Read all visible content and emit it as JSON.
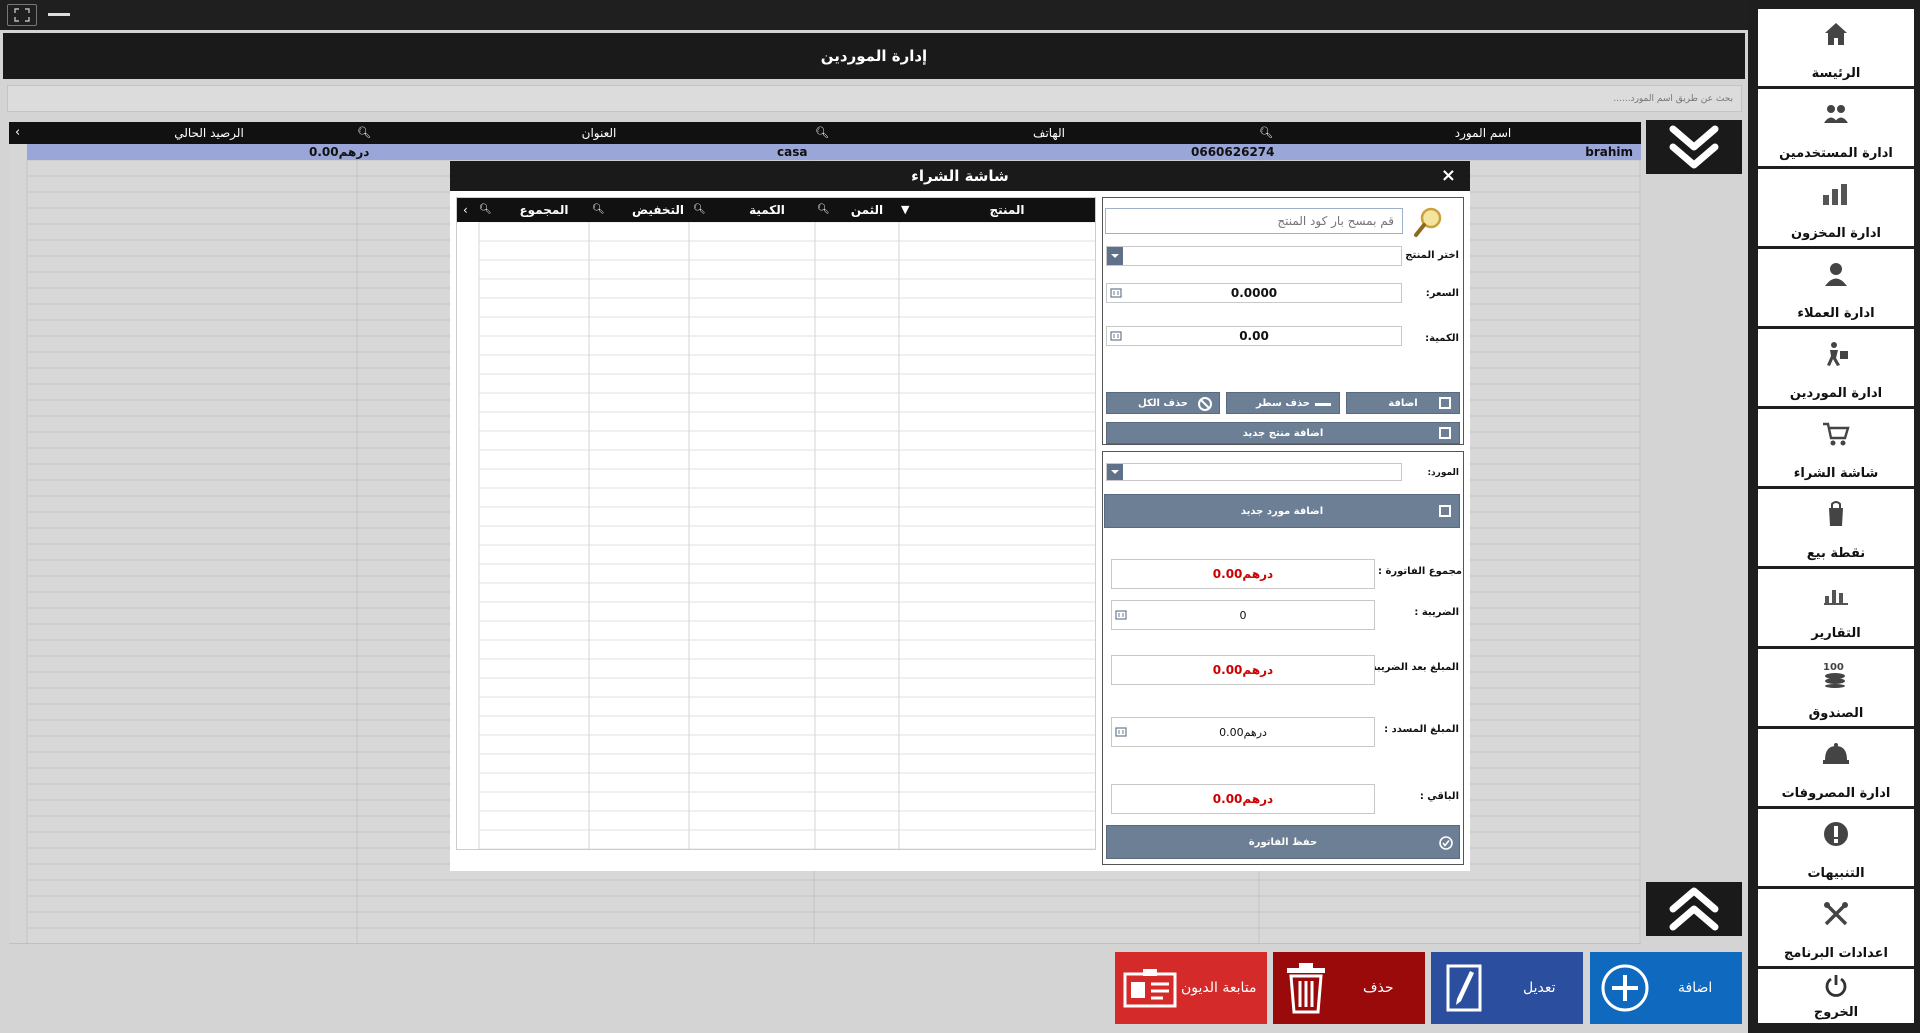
{
  "window": {
    "fullscreen_icon": "fullscreen-icon",
    "minimize_icon": "minimize-icon"
  },
  "page": {
    "title": "إدارة الموردين",
    "search_placeholder": "بحث عن طريق اسم المورد......"
  },
  "grid": {
    "columns": [
      "اسم المورد",
      "الهاتف",
      "العنوان",
      "الرصيد الحالي"
    ],
    "rows": [
      {
        "name": "brahim",
        "phone": "0660626274",
        "address": "casa",
        "balance": "درهم0.00"
      }
    ]
  },
  "actions": {
    "add": "اضافة",
    "edit": "تعديل",
    "delete": "حذف",
    "debts": "متابعة الديون"
  },
  "sidebar": {
    "items": [
      {
        "label": "الرئيسة",
        "icon": "home-icon"
      },
      {
        "label": "ادارة المستخدمين",
        "icon": "users-icon"
      },
      {
        "label": "ادارة المخزون",
        "icon": "inventory-icon"
      },
      {
        "label": "ادارة العملاء",
        "icon": "customer-icon"
      },
      {
        "label": "ادارة الموردين",
        "icon": "supplier-icon"
      },
      {
        "label": "شاشة الشراء",
        "icon": "cart-icon"
      },
      {
        "label": "نقطة بيع",
        "icon": "pos-icon"
      },
      {
        "label": "التقارير",
        "icon": "reports-icon"
      },
      {
        "label": "الصندوق",
        "icon": "cashbox-icon"
      },
      {
        "label": "ادارة المصروفات",
        "icon": "expenses-icon"
      },
      {
        "label": "التنبيهات",
        "icon": "alert-icon"
      },
      {
        "label": "اعدادات البرنامج",
        "icon": "settings-icon"
      },
      {
        "label": "الخروج",
        "icon": "power-icon"
      }
    ]
  },
  "modal": {
    "title": "شاشة الشراء",
    "close": "×",
    "table_columns": [
      "المنتج",
      "الثمن",
      "الكمية",
      "التخفيض",
      "المجموع"
    ],
    "barcode_placeholder": "قم بمسح بار كود المنتج",
    "product_label": "اختر المنتج :",
    "price_label": "السعر:",
    "price_value": "0.0000",
    "qty_label": "الكمية:",
    "qty_value": "0.00",
    "btn_add": "اضافة",
    "btn_delete_row": "حذف سطر",
    "btn_delete_all": "حذف الكل",
    "btn_new_product": "اضافة منتج جديد",
    "supplier_label": "المورد:",
    "btn_new_supplier": "اضافة مورد جديد",
    "total_label": "مجموع الفاتورة :",
    "total_value": "درهم0.00",
    "tax_label": "الضريبة :",
    "tax_value": "0",
    "after_tax_label": "المبلغ بعد الضريبة :",
    "after_tax_value": "درهم0.00",
    "paid_label": "المبلغ المسدد :",
    "paid_value": "درهم0.00",
    "remaining_label": "الباقي :",
    "remaining_value": "درهم0.00",
    "btn_save": "حفظ الفاتورة"
  }
}
